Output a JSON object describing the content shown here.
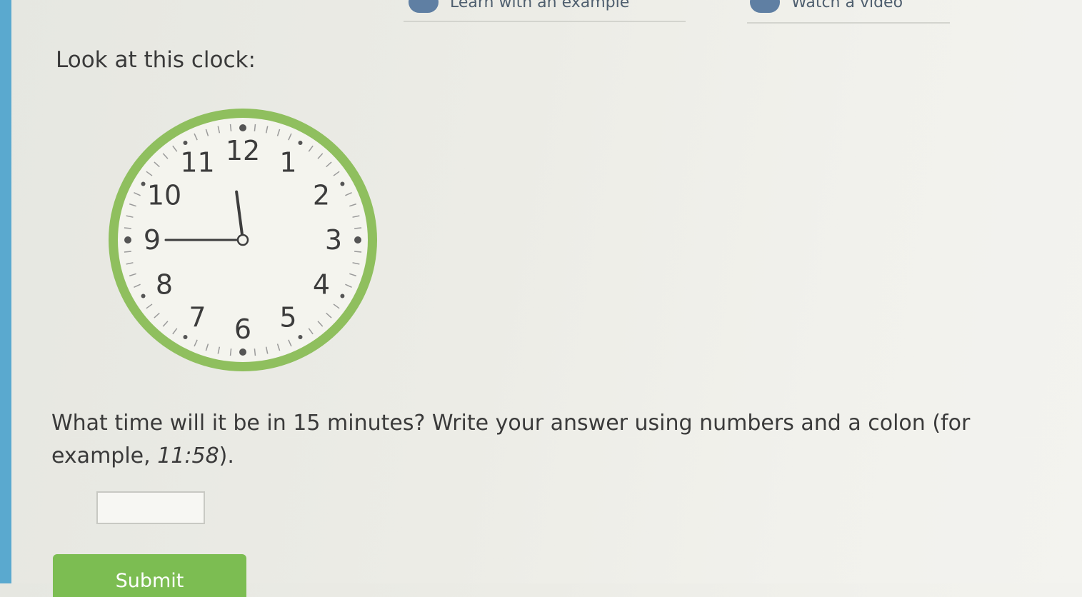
{
  "nav": {
    "tabs": [
      {
        "label": "Learn with an example",
        "icon": "lightbulb-icon"
      },
      {
        "label": "Watch a video",
        "icon": "play-icon"
      }
    ]
  },
  "prompt": "Look at this clock:",
  "clock": {
    "numbers": [
      "12",
      "1",
      "2",
      "3",
      "4",
      "5",
      "6",
      "7",
      "8",
      "9",
      "10",
      "11"
    ],
    "time_shown": "11:45",
    "ring_color": "#8fbf5e"
  },
  "question": {
    "text_before": "What time will it be in 15 minutes? Write your answer using numbers and a colon (for example, ",
    "example_value": "11:58",
    "text_after": ")."
  },
  "answer": {
    "value": "",
    "placeholder": ""
  },
  "submit_label": "Submit",
  "colors": {
    "accent_green": "#7cbd52",
    "left_stripe": "#5aa9cf"
  }
}
